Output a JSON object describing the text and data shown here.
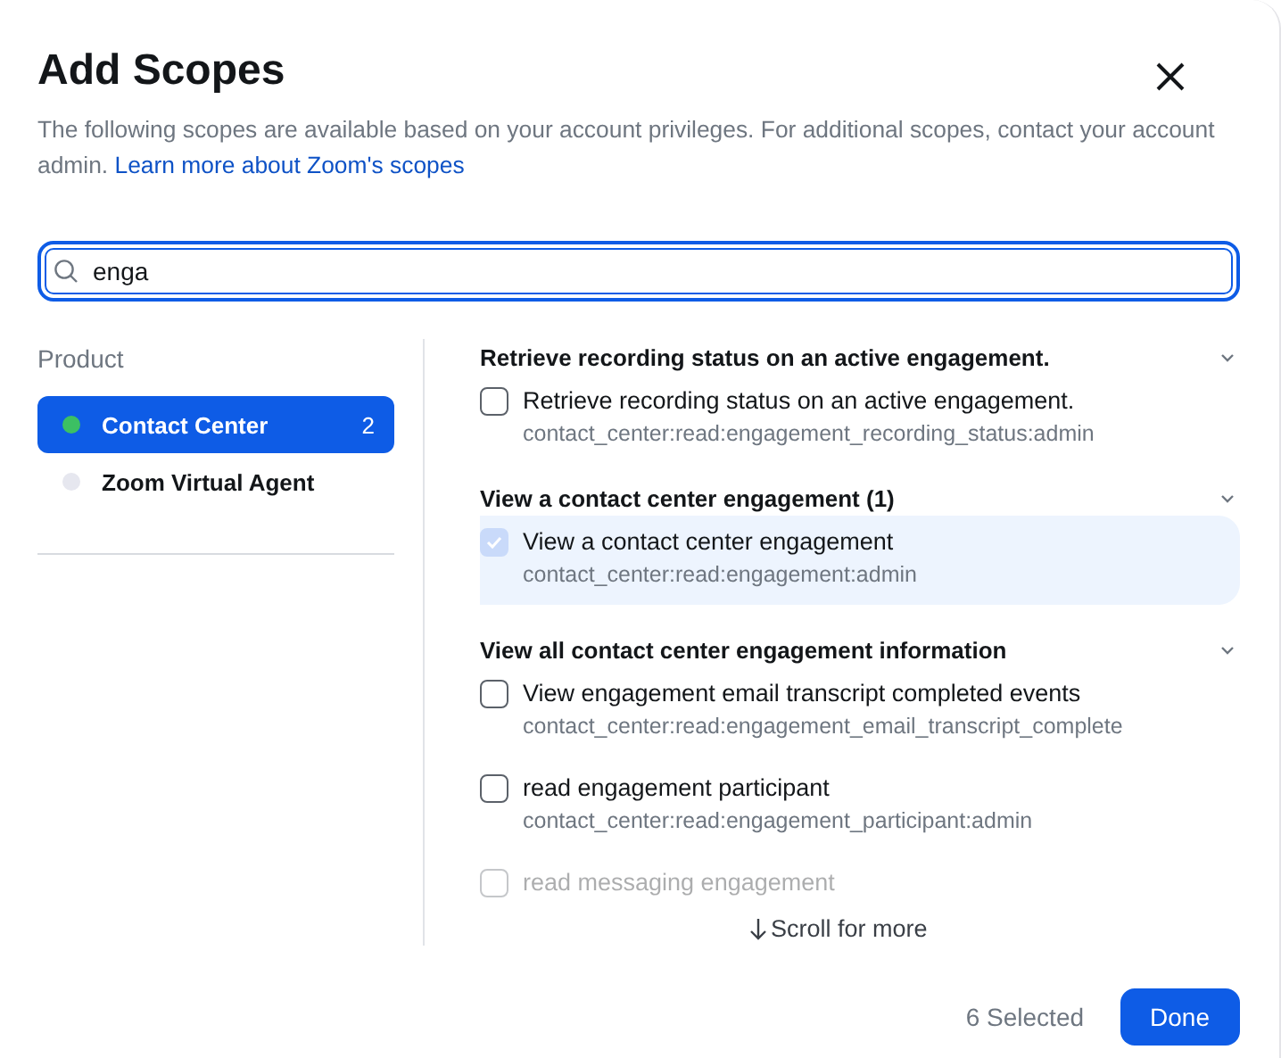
{
  "dialog": {
    "title": "Add Scopes",
    "description": "The following scopes are available based on your account privileges. For additional scopes, contact your account admin.",
    "learn_more_link": "Learn more about Zoom's scopes"
  },
  "search": {
    "value": "enga"
  },
  "sidebar": {
    "heading": "Product",
    "items": [
      {
        "label": "Contact Center",
        "count": "2",
        "selected": true,
        "color": "#3cc063"
      },
      {
        "label": "Zoom Virtual Agent",
        "selected": false,
        "color": "#e6e7ef"
      }
    ]
  },
  "groups": [
    {
      "title": "Retrieve recording status on an active engagement.",
      "expanded": true,
      "scopes": [
        {
          "name": "Retrieve recording status on an active engagement.",
          "code": "contact_center:read:engagement_recording_status:admin",
          "checked": false
        }
      ]
    },
    {
      "title": "View a contact center engagement (1)",
      "expanded": true,
      "scopes": [
        {
          "name": "View a contact center engagement",
          "code": "contact_center:read:engagement:admin",
          "checked": true
        }
      ]
    },
    {
      "title": "View all contact center engagement information",
      "expanded": true,
      "scopes": [
        {
          "name": "View engagement email transcript completed events",
          "code": "contact_center:read:engagement_email_transcript_complete",
          "checked": false
        },
        {
          "name": "read engagement participant",
          "code": "contact_center:read:engagement_participant:admin",
          "checked": false
        },
        {
          "name": "read messaging engagement",
          "checked": false
        }
      ]
    }
  ],
  "scroll_hint": "Scroll for more",
  "footer": {
    "selected_count": "6 Selected",
    "done_button": "Done"
  }
}
